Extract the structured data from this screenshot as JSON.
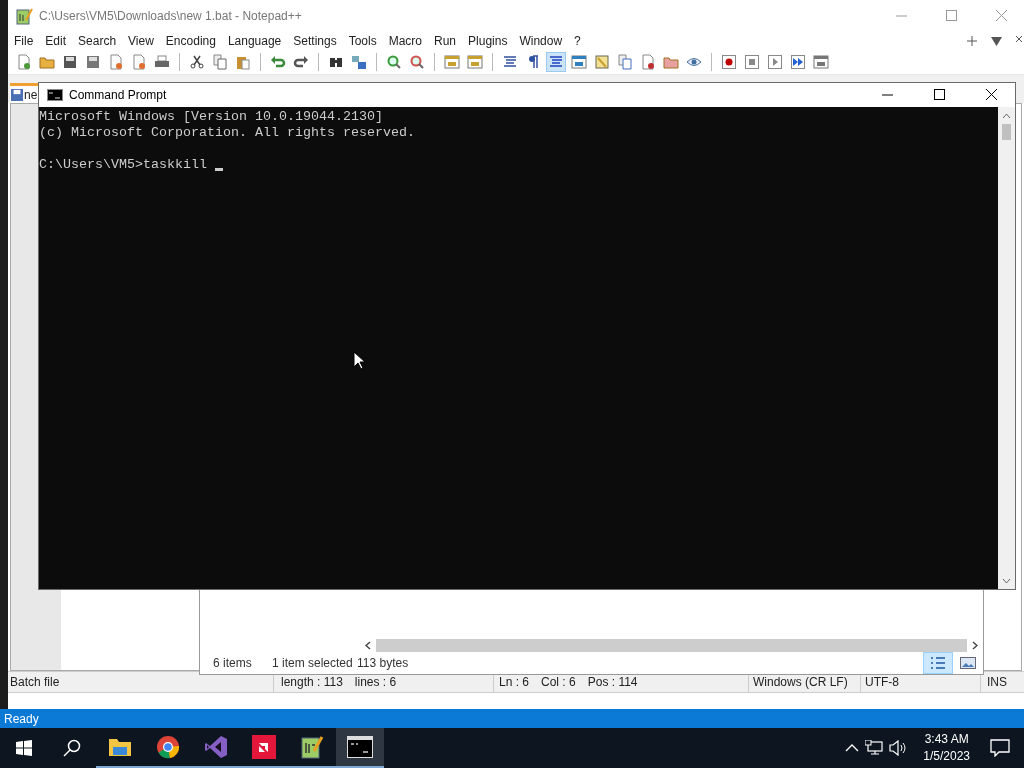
{
  "notepad": {
    "title": "C:\\Users\\VM5\\Downloads\\new 1.bat - Notepad++",
    "menu": [
      "File",
      "Edit",
      "Search",
      "View",
      "Encoding",
      "Language",
      "Settings",
      "Tools",
      "Macro",
      "Run",
      "Plugins",
      "Window",
      "?"
    ],
    "toolbar_buttons": [
      {
        "selected": false
      },
      {
        "selected": false
      },
      {
        "selected": false
      },
      {
        "selected": false
      },
      {
        "selected": false
      },
      {
        "selected": false
      },
      {
        "selected": false
      },
      {
        "selected": false
      },
      {
        "selected": false
      },
      {
        "selected": false
      },
      {
        "selected": false
      },
      {
        "selected": false
      },
      {
        "selected": false
      },
      {
        "selected": false
      },
      {
        "selected": false
      },
      {
        "selected": false
      },
      {
        "selected": false
      },
      {
        "selected": false
      },
      {
        "selected": false
      },
      {
        "selected": false
      },
      {
        "selected": true
      },
      {
        "selected": false
      },
      {
        "selected": false
      },
      {
        "selected": false
      },
      {
        "selected": false
      },
      {
        "selected": false
      },
      {
        "selected": false
      },
      {
        "selected": false
      },
      {
        "selected": false
      },
      {
        "selected": false
      },
      {
        "selected": false
      },
      {
        "selected": false
      }
    ],
    "tab": {
      "label": "ne"
    },
    "status_bar": {
      "file_type": "Batch file",
      "length": "length : 113",
      "lines": "lines : 6",
      "line": "Ln : 6",
      "column": "Col : 6",
      "position": "Pos : 114",
      "eol": "Windows (CR LF)",
      "encoding": "UTF-8",
      "mode": "INS"
    }
  },
  "explorer": {
    "item_count": "6 items",
    "selection": "1 item selected",
    "size": "113 bytes",
    "view_buttons": [
      {
        "selected": true
      },
      {
        "selected": false
      }
    ]
  },
  "command_prompt": {
    "title": "Command Prompt",
    "lines": [
      "Microsoft Windows [Version 10.0.19044.2130]",
      "(c) Microsoft Corporation. All rights reserved."
    ],
    "prompt": "C:\\Users\\VM5>taskkill"
  },
  "status_strip": {
    "text": "Ready"
  },
  "taskbar": {
    "apps": [
      {
        "kind": "files",
        "selected": false
      },
      {
        "kind": "browser",
        "selected": false
      },
      {
        "kind": "studio",
        "selected": false
      },
      {
        "kind": "red",
        "selected": false
      },
      {
        "kind": "notepad",
        "selected": false
      },
      {
        "kind": "terminal",
        "selected": true
      }
    ],
    "time": "3:43 AM",
    "date": "1/5/2023"
  }
}
